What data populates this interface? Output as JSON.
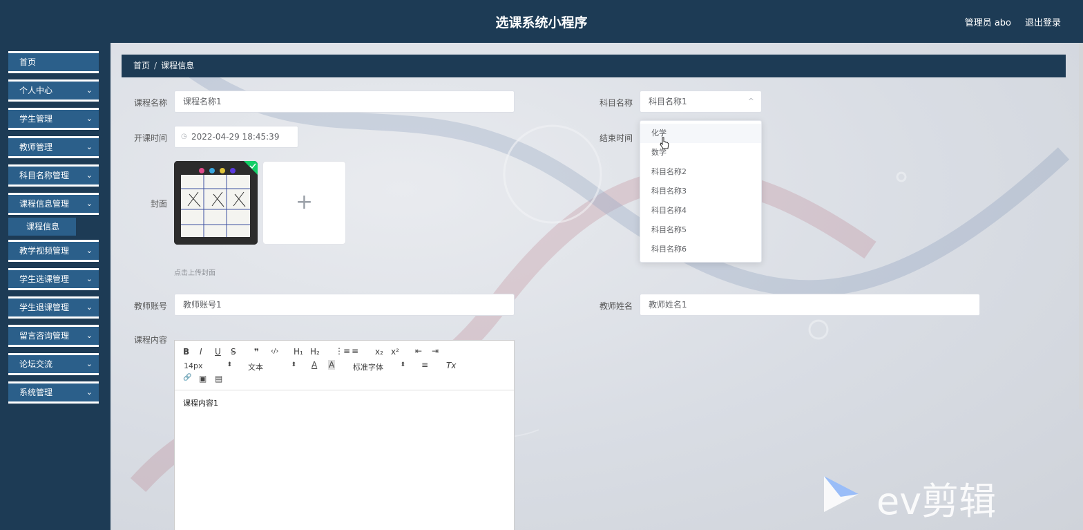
{
  "header": {
    "title": "选课系统小程序",
    "user": "管理员 abo",
    "logout": "退出登录"
  },
  "sidebar": {
    "items": [
      {
        "label": "首页",
        "chevron": ""
      },
      {
        "label": "个人中心",
        "chevron": "⌄"
      },
      {
        "label": "学生管理",
        "chevron": "⌄"
      },
      {
        "label": "教师管理",
        "chevron": "⌄"
      },
      {
        "label": "科目名称管理",
        "chevron": "⌄"
      },
      {
        "label": "课程信息管理",
        "chevron": "⌄"
      },
      {
        "label": "教学视频管理",
        "chevron": "⌄"
      },
      {
        "label": "学生选课管理",
        "chevron": "⌄"
      },
      {
        "label": "学生退课管理",
        "chevron": "⌄"
      },
      {
        "label": "留言咨询管理",
        "chevron": "⌄"
      },
      {
        "label": "论坛交流",
        "chevron": "⌄"
      },
      {
        "label": "系统管理",
        "chevron": "⌄"
      }
    ],
    "sub_item": "课程信息"
  },
  "breadcrumb": {
    "home": "首页",
    "separator": "/",
    "current": "课程信息"
  },
  "form": {
    "course_name": {
      "label": "课程名称",
      "value": "课程名称1"
    },
    "subject_name": {
      "label": "科目名称",
      "value": "科目名称1",
      "caret": "^"
    },
    "start_time": {
      "label": "开课时间",
      "value": "2022-04-29 18:45:39",
      "icon": "clock-icon"
    },
    "end_time": {
      "label": "结束时间"
    },
    "cover": {
      "label": "封面",
      "hint": "点击上传封面",
      "add": "+"
    },
    "teacher_account": {
      "label": "教师账号",
      "value": "教师账号1"
    },
    "teacher_name": {
      "label": "教师姓名",
      "value": "教师姓名1"
    },
    "content": {
      "label": "课程内容",
      "body": "课程内容1"
    }
  },
  "editor_toolbar": {
    "bold": "B",
    "italic": "I",
    "underline": "U",
    "strike": "S",
    "quote": "❞",
    "code": "‹/›",
    "h1": "H₁",
    "h2": "H₂",
    "ordered": "⋮≡",
    "bullet": "≡",
    "sub": "x₂",
    "sup": "x²",
    "outdent": "⇤",
    "indent": "⇥",
    "size": "14px",
    "header": "文本",
    "color": "A",
    "background": "A",
    "font": "标准字体",
    "align": "≡",
    "clean": "Tx",
    "link": "🔗",
    "image": "▣",
    "video": "▤",
    "select_arrow": "⬍"
  },
  "dropdown": {
    "options": [
      "化学",
      "数学",
      "科目名称2",
      "科目名称3",
      "科目名称4",
      "科目名称5",
      "科目名称6"
    ],
    "hovered": "化学"
  },
  "watermark": {
    "text": "ev剪辑"
  },
  "colors": {
    "navy": "#1d3b55",
    "nav_item": "#2b5f8a",
    "page_bg": "#e3e6eb"
  }
}
